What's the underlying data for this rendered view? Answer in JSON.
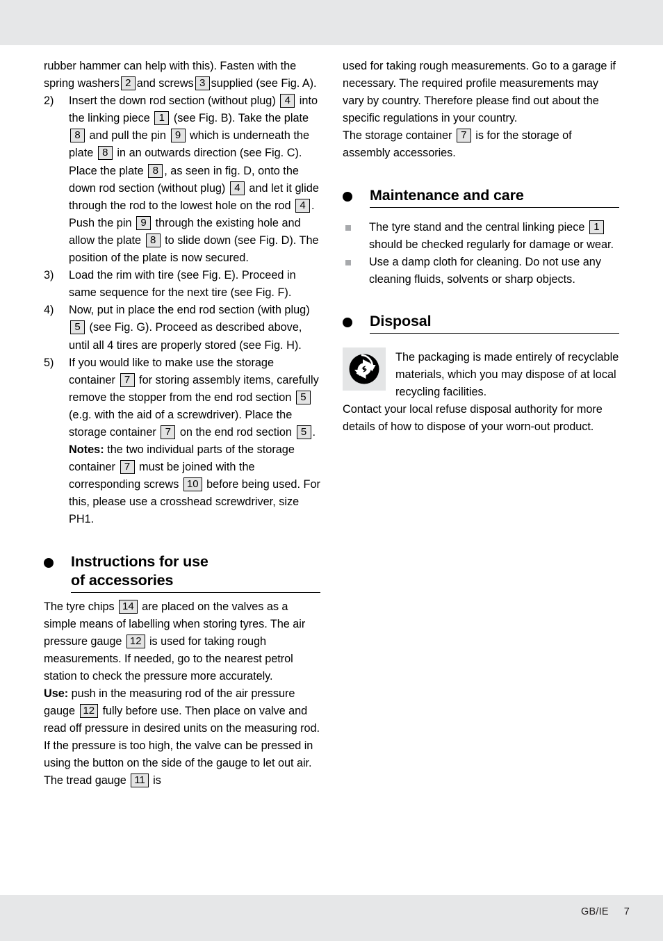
{
  "page": {
    "background_color": "#e6e7e8",
    "paper_color": "#ffffff",
    "ref_box_fill": "#e4e4e4",
    "square_bullet_color": "#a7a9ac"
  },
  "left_column": {
    "continuation_paragraph": {
      "line1": "rubber hammer can help with this). Fasten with",
      "line2_a": "the spring washers",
      "ref_2": "2",
      "line2_b": "and screws",
      "ref_3": "3",
      "line2_c": "supplied",
      "line3": "(see Fig. A)."
    },
    "steps": [
      {
        "marker": "2)",
        "parts": [
          {
            "t": "Insert the down rod section (without plug)"
          },
          {
            "ref": "4"
          },
          {
            "t": "into the linking piece"
          },
          {
            "ref": "1"
          },
          {
            "t": "(see Fig. B). Take the plate"
          },
          {
            "ref": "8"
          },
          {
            "t": "and pull the pin"
          },
          {
            "ref": "9"
          },
          {
            "t": "which is underneath the plate"
          },
          {
            "ref": "8"
          },
          {
            "t": "in an outwards direction (see Fig. C). Place the plate"
          },
          {
            "ref": "8"
          },
          {
            "t": ", as seen in fig. D, onto the down rod section (without plug)"
          },
          {
            "ref": "4"
          },
          {
            "t": "and let it glide through the rod to the lowest hole on the rod"
          },
          {
            "ref": "4"
          },
          {
            "t": ". Push the pin"
          },
          {
            "ref": "9"
          },
          {
            "t": "through the existing hole and allow the plate"
          },
          {
            "ref": "8"
          },
          {
            "t": "to slide down (see Fig. D). The position of the plate is now secured."
          }
        ]
      },
      {
        "marker": "3)",
        "parts": [
          {
            "t": "Load the rim with tire (see Fig. E). Proceed in same sequence for the next tire (see Fig. F)."
          }
        ]
      },
      {
        "marker": "4)",
        "parts": [
          {
            "t": "Now, put in place the end rod section (with plug)"
          },
          {
            "ref": "5"
          },
          {
            "t": "(see Fig. G). Proceed as described above, until all 4 tires are properly stored (see Fig. H)."
          }
        ]
      },
      {
        "marker": "5)",
        "parts": [
          {
            "t": "If you would like to make use the storage container"
          },
          {
            "ref": "7"
          },
          {
            "t": "for storing assembly items, carefully remove the stopper from the end rod section"
          },
          {
            "ref": "5"
          },
          {
            "t": "(e.g. with the aid of a screwdriver). Place the storage container"
          },
          {
            "ref": "7"
          },
          {
            "t": "on the end rod section"
          },
          {
            "ref": "5"
          },
          {
            "t": "."
          }
        ],
        "notes": {
          "label": "Notes:",
          "parts": [
            {
              "t": "the two individual parts of the storage container"
            },
            {
              "ref": "7"
            },
            {
              "t": "must be joined with the corresponding screws"
            },
            {
              "ref": "10"
            },
            {
              "t": "before being used. For this, please use a crosshead screwdriver, size PH1."
            }
          ]
        }
      }
    ],
    "instructions_heading": {
      "line1": "Instructions for use",
      "line2": "of accessories",
      "bullet_icon": "filled-circle-icon"
    },
    "instructions_body": [
      {
        "t": "The tyre chips"
      },
      {
        "ref": "14"
      },
      {
        "t": "are placed on the valves as a simple means of labelling when storing tyres. The air pressure gauge"
      },
      {
        "ref": "12"
      },
      {
        "t": "is used for taking rough measurements. If needed, go to the nearest petrol station to check the pressure more accurately."
      }
    ],
    "use_paragraph": {
      "label": "Use:",
      "parts": [
        {
          "t": "push in the measuring rod of the air pressure gauge"
        },
        {
          "ref": "12"
        },
        {
          "t": "fully before use. Then place on valve and read off pressure in desired units on the measuring rod. If the pressure is too high, the valve can be pressed in using the button on the side of the gauge to let out air. The tread gauge"
        },
        {
          "ref": "11"
        },
        {
          "t": "is"
        }
      ]
    }
  },
  "right_column": {
    "continuation_paragraph": {
      "parts": [
        {
          "t": "used for taking rough measurements. Go to a garage if necessary. The required profile measurements may vary by country. Therefore please find out about the specific regulations in your country."
        }
      ]
    },
    "storage_paragraph": {
      "parts": [
        {
          "t": "The storage container"
        },
        {
          "ref": "7"
        },
        {
          "t": "is for the storage of assembly accessories."
        }
      ]
    },
    "maintenance_heading": {
      "text": "Maintenance and care",
      "bullet_icon": "filled-circle-icon"
    },
    "maintenance_items": [
      [
        {
          "t": "The tyre stand and the central linking piece"
        },
        {
          "ref": "1"
        },
        {
          "t": "should be checked regularly for damage or wear."
        }
      ],
      [
        {
          "t": "Use a damp cloth for cleaning. Do not use any cleaning fluids, solvents or sharp objects."
        }
      ]
    ],
    "disposal_heading": {
      "text": "Disposal",
      "bullet_icon": "filled-circle-icon"
    },
    "disposal_icon_name": "green-dot-recycling-icon",
    "disposal_text": "The packaging is made entirely of recyclable materials, which you may dispose of at local recycling facilities.",
    "disposal_followup": "Contact your local refuse disposal authority for more details of how to dispose of your worn-out product."
  },
  "footer": {
    "locale": "GB/IE",
    "page_number": "7"
  }
}
